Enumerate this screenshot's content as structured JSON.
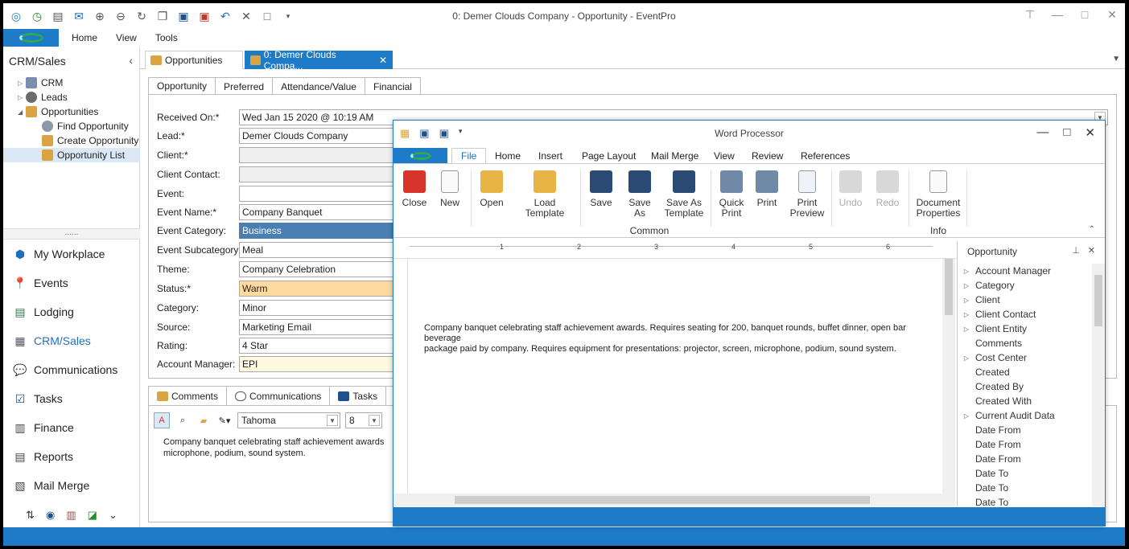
{
  "window": {
    "title": "0: Demer Clouds Company - Opportunity - EventPro"
  },
  "menu": [
    "Home",
    "View",
    "Tools"
  ],
  "nav": {
    "header": "CRM/Sales",
    "tree": [
      {
        "label": "CRM",
        "level": 0,
        "arrow": "▷"
      },
      {
        "label": "Leads",
        "level": 0,
        "arrow": "▷"
      },
      {
        "label": "Opportunities",
        "level": 0,
        "arrow": "◢"
      },
      {
        "label": "Find Opportunity",
        "level": 1,
        "arrow": ""
      },
      {
        "label": "Create Opportunity",
        "level": 1,
        "arrow": ""
      },
      {
        "label": "Opportunity List",
        "level": 1,
        "arrow": ""
      }
    ],
    "grip": "......",
    "modules": [
      "My Workplace",
      "Events",
      "Lodging",
      "CRM/Sales",
      "Communications",
      "Tasks",
      "Finance",
      "Reports",
      "Mail Merge"
    ]
  },
  "doctabs": {
    "tab1": "Opportunities",
    "tab2": "0: Demer Clouds Compa..."
  },
  "form": {
    "tabs": [
      "Opportunity",
      "Preferred",
      "Attendance/Value",
      "Financial"
    ],
    "fields": [
      {
        "label": "Received On:*",
        "value": "Wed Jan 15 2020 @ 10:19 AM"
      },
      {
        "label": "Lead:*",
        "value": "Demer Clouds Company"
      },
      {
        "label": "Client:*",
        "value": ""
      },
      {
        "label": "Client Contact:",
        "value": ""
      },
      {
        "label": "Event:",
        "value": ""
      },
      {
        "label": "Event Name:*",
        "value": "Company Banquet"
      },
      {
        "label": "Event Category:",
        "value": "Business"
      },
      {
        "label": "Event Subcategory:",
        "value": "Meal"
      },
      {
        "label": "Theme:",
        "value": "Company Celebration"
      },
      {
        "label": "Status:*",
        "value": "Warm"
      },
      {
        "label": "Category:",
        "value": "Minor"
      },
      {
        "label": "Source:",
        "value": "Marketing Email"
      },
      {
        "label": "Rating:",
        "value": "4 Star"
      },
      {
        "label": "Account Manager:",
        "value": "EPI"
      }
    ]
  },
  "comments": {
    "tabs": [
      "Comments",
      "Communications",
      "Tasks"
    ],
    "font": "Tahoma",
    "size": "8",
    "text_line1": "Company banquet celebrating staff achievement awards",
    "text_line2": "microphone, podium, sound system."
  },
  "wordprocessor": {
    "title": "Word Processor",
    "tabs": [
      "File",
      "Home",
      "Insert",
      "Page Layout",
      "Mail Merge",
      "View",
      "Review",
      "References"
    ],
    "buttons": {
      "close": "Close",
      "new": "New",
      "open": "Open",
      "load_template": "Load Template",
      "save": "Save",
      "save_as": "Save As",
      "save_as_template_1": "Save As",
      "save_as_template_2": "Template",
      "quick_print_1": "Quick",
      "quick_print_2": "Print",
      "print": "Print",
      "print_preview_1": "Print",
      "print_preview_2": "Preview",
      "undo": "Undo",
      "redo": "Redo",
      "doc_props_1": "Document",
      "doc_props_2": "Properties"
    },
    "groups": {
      "common": "Common",
      "info": "Info"
    },
    "ruler_numbers": [
      "1",
      "2",
      "3",
      "4",
      "5",
      "6"
    ],
    "document_line1": "Company banquet celebrating staff achievement awards. Requires seating for 200, banquet rounds, buffet dinner, open bar beverage",
    "document_line2": "package paid by company. Requires equipment for presentations: projector, screen, microphone, podium, sound system.",
    "fieldpanel": {
      "title": "Opportunity",
      "items": [
        {
          "label": "Account Manager",
          "expand": true
        },
        {
          "label": "Category",
          "expand": true
        },
        {
          "label": "Client",
          "expand": true
        },
        {
          "label": "Client Contact",
          "expand": true
        },
        {
          "label": "Client Entity",
          "expand": true
        },
        {
          "label": "Comments",
          "expand": false
        },
        {
          "label": "Cost Center",
          "expand": true
        },
        {
          "label": "Created",
          "expand": false
        },
        {
          "label": "Created By",
          "expand": false
        },
        {
          "label": "Created With",
          "expand": false
        },
        {
          "label": "Current Audit Data",
          "expand": true
        },
        {
          "label": "Date From",
          "expand": false
        },
        {
          "label": "Date From",
          "expand": false
        },
        {
          "label": "Date From",
          "expand": false
        },
        {
          "label": "Date To",
          "expand": false
        },
        {
          "label": "Date To",
          "expand": false
        },
        {
          "label": "Date To",
          "expand": false
        }
      ]
    }
  },
  "colors": {
    "accent": "#1e7bc8",
    "business": "#4a7fb3",
    "warm": "#ffdaa0"
  }
}
